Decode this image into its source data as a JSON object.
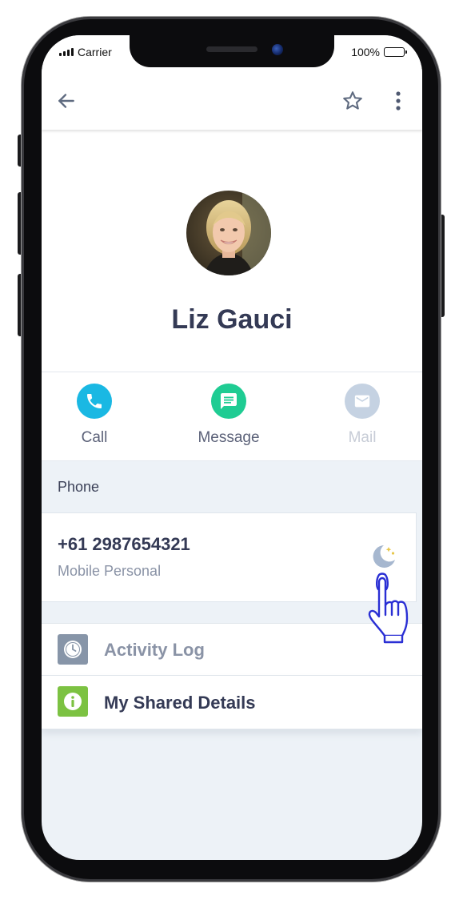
{
  "status_bar": {
    "carrier": "Carrier",
    "battery": "100%"
  },
  "app_bar": {
    "back_icon": "arrow-left",
    "favorite_icon": "star-outline",
    "more_icon": "more-vertical"
  },
  "contact": {
    "name": "Liz Gauci"
  },
  "actions": [
    {
      "label": "Call",
      "icon": "phone",
      "color": "#1ab8e3",
      "enabled": true
    },
    {
      "label": "Message",
      "icon": "message",
      "color": "#1fcc93",
      "enabled": true
    },
    {
      "label": "Mail",
      "icon": "mail",
      "color": "#c5d2e2",
      "enabled": false
    }
  ],
  "phone_section": {
    "header": "Phone",
    "number": "+61 2987654321",
    "type": "Mobile Personal",
    "status_icon": "moon-do-not-disturb"
  },
  "list": [
    {
      "label": "Activity Log",
      "icon": "clock",
      "icon_color": "#8795a8"
    },
    {
      "label": "My Shared Details",
      "icon": "info",
      "icon_color": "#7cc242"
    }
  ],
  "colors": {
    "name_text": "#343a55",
    "screen_bg": "#edf2f7",
    "hand_pointer": "#2a2fd4"
  }
}
